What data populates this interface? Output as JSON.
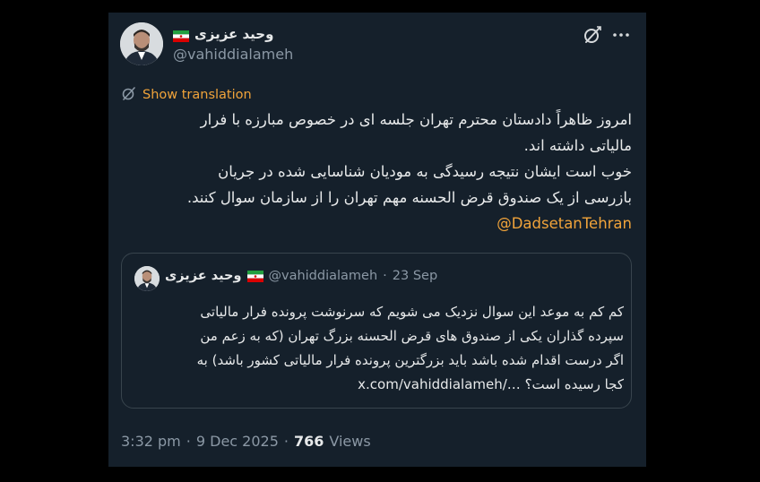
{
  "colors": {
    "background": "#000000",
    "card": "#15202b",
    "text": "#e7e9ea",
    "secondary": "#8b98a5",
    "accent": "#f0a33a",
    "border": "#38444d"
  },
  "author": {
    "display_name": "وحید عزیزی",
    "handle": "@vahiddialameh",
    "flag_icon": "iran-flag-icon"
  },
  "header_icons": [
    "grok-icon",
    "more-icon"
  ],
  "header_more_label": "···",
  "translation": {
    "icon": "translate-icon",
    "label": "Show translation"
  },
  "tweet": {
    "lines": [
      "امروز ظاهراً دادستان محترم تهران جلسه ای در خصوص مبارزه با فرار",
      "مالیاتی داشته اند.",
      "خوب است ایشان نتیجه رسیدگی به مودیان شناسایی شده در جریان",
      "بازرسی از یک صندوق قرض الحسنه مهم تهران را از سازمان سوال کنند."
    ],
    "mention": "@DadsetanTehran"
  },
  "quoted": {
    "display_name": "وحید عزیزی",
    "handle": "@vahiddialameh",
    "separator": "·",
    "date": "23 Sep",
    "lines": [
      "کم کم به موعد این سوال نزدیک می شویم که سرنوشت پرونده فرار مالیاتی",
      "سپرده گذاران یکی از صندوق های قرض الحسنه بزرگ تهران (که به زعم من",
      "اگر درست اقدام شده باشد باید بزرگترین پرونده فرار مالیاتی کشور باشد) به"
    ],
    "last_line_text": "کجا رسیده است؟",
    "link": "x.com/vahiddialameh/…"
  },
  "meta": {
    "time": "3:32 pm",
    "sep1": "·",
    "date": "9 Dec 2025",
    "sep2": "·",
    "views_count": "766",
    "views_label": "Views"
  }
}
